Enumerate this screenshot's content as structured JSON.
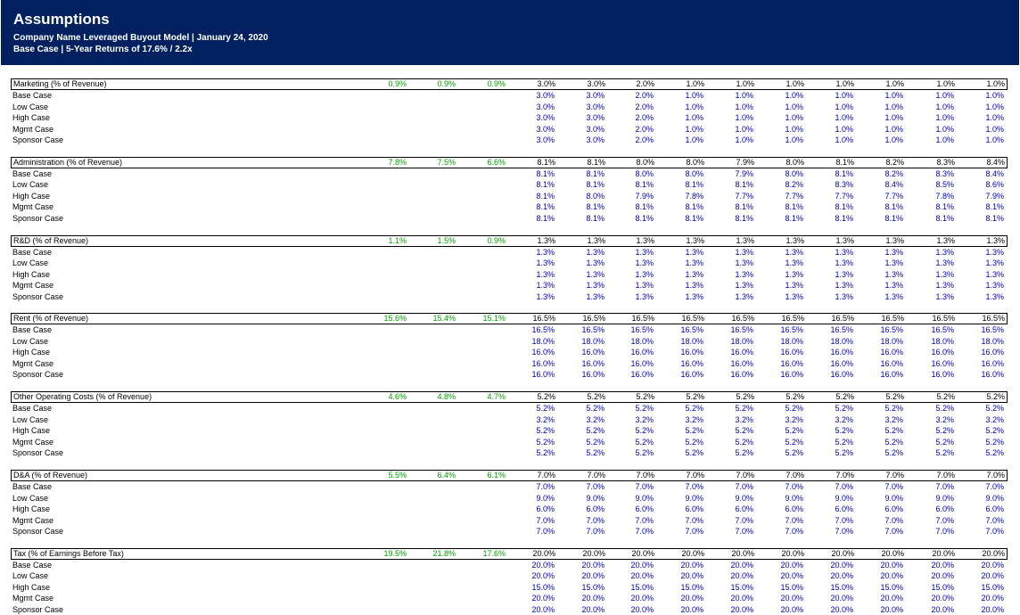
{
  "header": {
    "title": "Assumptions",
    "subtitle1": "Company Name Leveraged Buyout Model | January 24, 2020",
    "subtitle2": "Base Case | 5-Year Returns of 17.6% / 2.2x"
  },
  "colors": {
    "header_bg": "#002060",
    "historical": "#00a000",
    "input": "#0000c0"
  },
  "sections": [
    {
      "label": "Marketing (% of Revenue)",
      "historical": [
        "0.9%",
        "0.9%",
        "0.9%"
      ],
      "projected": [
        "3.0%",
        "3.0%",
        "2.0%",
        "1.0%",
        "1.0%",
        "1.0%",
        "1.0%",
        "1.0%",
        "1.0%",
        "1.0%"
      ],
      "cases": [
        {
          "label": "Base Case",
          "values": [
            "3.0%",
            "3.0%",
            "2.0%",
            "1.0%",
            "1.0%",
            "1.0%",
            "1.0%",
            "1.0%",
            "1.0%",
            "1.0%"
          ]
        },
        {
          "label": "Low Case",
          "values": [
            "3.0%",
            "3.0%",
            "2.0%",
            "1.0%",
            "1.0%",
            "1.0%",
            "1.0%",
            "1.0%",
            "1.0%",
            "1.0%"
          ]
        },
        {
          "label": "High Case",
          "values": [
            "3.0%",
            "3.0%",
            "2.0%",
            "1.0%",
            "1.0%",
            "1.0%",
            "1.0%",
            "1.0%",
            "1.0%",
            "1.0%"
          ]
        },
        {
          "label": "Mgmt Case",
          "values": [
            "3.0%",
            "3.0%",
            "2.0%",
            "1.0%",
            "1.0%",
            "1.0%",
            "1.0%",
            "1.0%",
            "1.0%",
            "1.0%"
          ]
        },
        {
          "label": "Sponsor Case",
          "values": [
            "3.0%",
            "3.0%",
            "2.0%",
            "1.0%",
            "1.0%",
            "1.0%",
            "1.0%",
            "1.0%",
            "1.0%",
            "1.0%"
          ]
        }
      ]
    },
    {
      "label": "Administration (% of Revenue)",
      "historical": [
        "7.8%",
        "7.5%",
        "6.6%"
      ],
      "projected": [
        "8.1%",
        "8.1%",
        "8.0%",
        "8.0%",
        "7.9%",
        "8.0%",
        "8.1%",
        "8.2%",
        "8.3%",
        "8.4%"
      ],
      "cases": [
        {
          "label": "Base Case",
          "values": [
            "8.1%",
            "8.1%",
            "8.0%",
            "8.0%",
            "7.9%",
            "8.0%",
            "8.1%",
            "8.2%",
            "8.3%",
            "8.4%"
          ]
        },
        {
          "label": "Low Case",
          "values": [
            "8.1%",
            "8.1%",
            "8.1%",
            "8.1%",
            "8.1%",
            "8.2%",
            "8.3%",
            "8.4%",
            "8.5%",
            "8.6%"
          ]
        },
        {
          "label": "High Case",
          "values": [
            "8.1%",
            "8.0%",
            "7.9%",
            "7.8%",
            "7.7%",
            "7.7%",
            "7.7%",
            "7.7%",
            "7.8%",
            "7.9%"
          ]
        },
        {
          "label": "Mgmt Case",
          "values": [
            "8.1%",
            "8.1%",
            "8.1%",
            "8.1%",
            "8.1%",
            "8.1%",
            "8.1%",
            "8.1%",
            "8.1%",
            "8.1%"
          ]
        },
        {
          "label": "Sponsor Case",
          "values": [
            "8.1%",
            "8.1%",
            "8.1%",
            "8.1%",
            "8.1%",
            "8.1%",
            "8.1%",
            "8.1%",
            "8.1%",
            "8.1%"
          ]
        }
      ]
    },
    {
      "label": "R&D (% of Revenue)",
      "historical": [
        "1.1%",
        "1.5%",
        "0.9%"
      ],
      "projected": [
        "1.3%",
        "1.3%",
        "1.3%",
        "1.3%",
        "1.3%",
        "1.3%",
        "1.3%",
        "1.3%",
        "1.3%",
        "1.3%"
      ],
      "cases": [
        {
          "label": "Base Case",
          "values": [
            "1.3%",
            "1.3%",
            "1.3%",
            "1.3%",
            "1.3%",
            "1.3%",
            "1.3%",
            "1.3%",
            "1.3%",
            "1.3%"
          ]
        },
        {
          "label": "Low Case",
          "values": [
            "1.3%",
            "1.3%",
            "1.3%",
            "1.3%",
            "1.3%",
            "1.3%",
            "1.3%",
            "1.3%",
            "1.3%",
            "1.3%"
          ]
        },
        {
          "label": "High Case",
          "values": [
            "1.3%",
            "1.3%",
            "1.3%",
            "1.3%",
            "1.3%",
            "1.3%",
            "1.3%",
            "1.3%",
            "1.3%",
            "1.3%"
          ]
        },
        {
          "label": "Mgmt Case",
          "values": [
            "1.3%",
            "1.3%",
            "1.3%",
            "1.3%",
            "1.3%",
            "1.3%",
            "1.3%",
            "1.3%",
            "1.3%",
            "1.3%"
          ]
        },
        {
          "label": "Sponsor Case",
          "values": [
            "1.3%",
            "1.3%",
            "1.3%",
            "1.3%",
            "1.3%",
            "1.3%",
            "1.3%",
            "1.3%",
            "1.3%",
            "1.3%"
          ]
        }
      ]
    },
    {
      "label": "Rent (% of Revenue)",
      "historical": [
        "15.6%",
        "15.4%",
        "15.1%"
      ],
      "projected": [
        "16.5%",
        "16.5%",
        "16.5%",
        "16.5%",
        "16.5%",
        "16.5%",
        "16.5%",
        "16.5%",
        "16.5%",
        "16.5%"
      ],
      "cases": [
        {
          "label": "Base Case",
          "values": [
            "16.5%",
            "16.5%",
            "16.5%",
            "16.5%",
            "16.5%",
            "16.5%",
            "16.5%",
            "16.5%",
            "16.5%",
            "16.5%"
          ]
        },
        {
          "label": "Low Case",
          "values": [
            "18.0%",
            "18.0%",
            "18.0%",
            "18.0%",
            "18.0%",
            "18.0%",
            "18.0%",
            "18.0%",
            "18.0%",
            "18.0%"
          ]
        },
        {
          "label": "High Case",
          "values": [
            "16.0%",
            "16.0%",
            "16.0%",
            "16.0%",
            "16.0%",
            "16.0%",
            "16.0%",
            "16.0%",
            "16.0%",
            "16.0%"
          ]
        },
        {
          "label": "Mgmt Case",
          "values": [
            "16.0%",
            "16.0%",
            "16.0%",
            "16.0%",
            "16.0%",
            "16.0%",
            "16.0%",
            "16.0%",
            "16.0%",
            "16.0%"
          ]
        },
        {
          "label": "Sponsor Case",
          "values": [
            "16.0%",
            "16.0%",
            "16.0%",
            "16.0%",
            "16.0%",
            "16.0%",
            "16.0%",
            "16.0%",
            "16.0%",
            "16.0%"
          ]
        }
      ]
    },
    {
      "label": "Other Operating Costs (% of Revenue)",
      "historical": [
        "4.6%",
        "4.8%",
        "4.7%"
      ],
      "projected": [
        "5.2%",
        "5.2%",
        "5.2%",
        "5.2%",
        "5.2%",
        "5.2%",
        "5.2%",
        "5.2%",
        "5.2%",
        "5.2%"
      ],
      "cases": [
        {
          "label": "Base Case",
          "values": [
            "5.2%",
            "5.2%",
            "5.2%",
            "5.2%",
            "5.2%",
            "5.2%",
            "5.2%",
            "5.2%",
            "5.2%",
            "5.2%"
          ]
        },
        {
          "label": "Low Case",
          "values": [
            "3.2%",
            "3.2%",
            "3.2%",
            "3.2%",
            "3.2%",
            "3.2%",
            "3.2%",
            "3.2%",
            "3.2%",
            "3.2%"
          ]
        },
        {
          "label": "High Case",
          "values": [
            "5.2%",
            "5.2%",
            "5.2%",
            "5.2%",
            "5.2%",
            "5.2%",
            "5.2%",
            "5.2%",
            "5.2%",
            "5.2%"
          ]
        },
        {
          "label": "Mgmt Case",
          "values": [
            "5.2%",
            "5.2%",
            "5.2%",
            "5.2%",
            "5.2%",
            "5.2%",
            "5.2%",
            "5.2%",
            "5.2%",
            "5.2%"
          ]
        },
        {
          "label": "Sponsor Case",
          "values": [
            "5.2%",
            "5.2%",
            "5.2%",
            "5.2%",
            "5.2%",
            "5.2%",
            "5.2%",
            "5.2%",
            "5.2%",
            "5.2%"
          ]
        }
      ]
    },
    {
      "label": "D&A (% of Revenue)",
      "historical": [
        "5.5%",
        "6.4%",
        "6.1%"
      ],
      "projected": [
        "7.0%",
        "7.0%",
        "7.0%",
        "7.0%",
        "7.0%",
        "7.0%",
        "7.0%",
        "7.0%",
        "7.0%",
        "7.0%"
      ],
      "cases": [
        {
          "label": "Base Case",
          "values": [
            "7.0%",
            "7.0%",
            "7.0%",
            "7.0%",
            "7.0%",
            "7.0%",
            "7.0%",
            "7.0%",
            "7.0%",
            "7.0%"
          ]
        },
        {
          "label": "Low Case",
          "values": [
            "9.0%",
            "9.0%",
            "9.0%",
            "9.0%",
            "9.0%",
            "9.0%",
            "9.0%",
            "9.0%",
            "9.0%",
            "9.0%"
          ]
        },
        {
          "label": "High Case",
          "values": [
            "6.0%",
            "6.0%",
            "6.0%",
            "6.0%",
            "6.0%",
            "6.0%",
            "6.0%",
            "6.0%",
            "6.0%",
            "6.0%"
          ]
        },
        {
          "label": "Mgmt Case",
          "values": [
            "7.0%",
            "7.0%",
            "7.0%",
            "7.0%",
            "7.0%",
            "7.0%",
            "7.0%",
            "7.0%",
            "7.0%",
            "7.0%"
          ]
        },
        {
          "label": "Sponsor Case",
          "values": [
            "7.0%",
            "7.0%",
            "7.0%",
            "7.0%",
            "7.0%",
            "7.0%",
            "7.0%",
            "7.0%",
            "7.0%",
            "7.0%"
          ]
        }
      ]
    },
    {
      "label": "Tax (% of Earnings Before Tax)",
      "historical": [
        "19.5%",
        "21.8%",
        "17.6%"
      ],
      "projected": [
        "20.0%",
        "20.0%",
        "20.0%",
        "20.0%",
        "20.0%",
        "20.0%",
        "20.0%",
        "20.0%",
        "20.0%",
        "20.0%"
      ],
      "cases": [
        {
          "label": "Base Case",
          "values": [
            "20.0%",
            "20.0%",
            "20.0%",
            "20.0%",
            "20.0%",
            "20.0%",
            "20.0%",
            "20.0%",
            "20.0%",
            "20.0%"
          ]
        },
        {
          "label": "Low Case",
          "values": [
            "20.0%",
            "20.0%",
            "20.0%",
            "20.0%",
            "20.0%",
            "20.0%",
            "20.0%",
            "20.0%",
            "20.0%",
            "20.0%"
          ]
        },
        {
          "label": "High Case",
          "values": [
            "15.0%",
            "15.0%",
            "15.0%",
            "15.0%",
            "15.0%",
            "15.0%",
            "15.0%",
            "15.0%",
            "15.0%",
            "15.0%"
          ]
        },
        {
          "label": "Mgmt Case",
          "values": [
            "20.0%",
            "20.0%",
            "20.0%",
            "20.0%",
            "20.0%",
            "20.0%",
            "20.0%",
            "20.0%",
            "20.0%",
            "20.0%"
          ]
        },
        {
          "label": "Sponsor Case",
          "values": [
            "20.0%",
            "20.0%",
            "20.0%",
            "20.0%",
            "20.0%",
            "20.0%",
            "20.0%",
            "20.0%",
            "20.0%",
            "20.0%"
          ]
        }
      ]
    }
  ]
}
